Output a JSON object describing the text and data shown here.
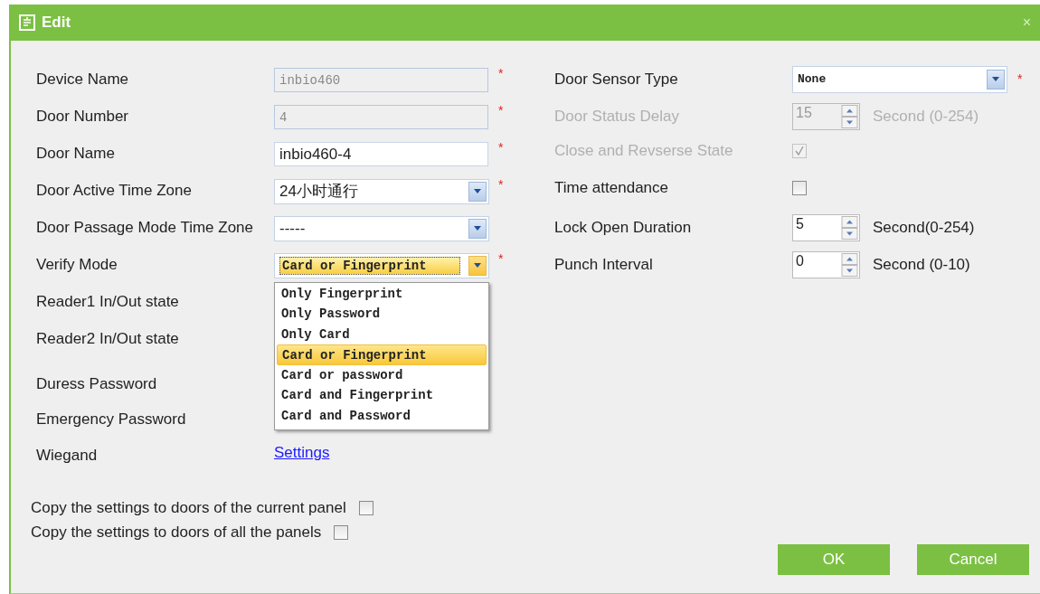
{
  "window": {
    "title": "Edit",
    "close": "×"
  },
  "left_fields": [
    {
      "label": "Device Name",
      "kind": "text",
      "value": "inbio460",
      "disabled": true,
      "mark": "*"
    },
    {
      "label": "Door Number",
      "kind": "text",
      "value": "4",
      "disabled": true,
      "mark": "*"
    },
    {
      "label": "Door Name",
      "kind": "text",
      "value": "inbio460-4",
      "disabled": false,
      "mark": "*"
    },
    {
      "label": "Door Active Time Zone",
      "kind": "select",
      "value": "24小时通行",
      "mark": "*"
    },
    {
      "label": "Door Passage Mode Time Zone",
      "kind": "select",
      "value": "-----"
    },
    {
      "label": "Verify Mode",
      "kind": "dropdown",
      "value": "Card or Fingerprint",
      "mark": "*",
      "expanded": true,
      "options": [
        {
          "label": "Only Fingerprint",
          "selected": false
        },
        {
          "label": "Only Password",
          "selected": false
        },
        {
          "label": "Only Card",
          "selected": false
        },
        {
          "label": "Card or Fingerprint",
          "selected": true
        },
        {
          "label": "Card or password",
          "selected": false
        },
        {
          "label": "Card and Fingerprint",
          "selected": false
        },
        {
          "label": "Card and Password",
          "selected": false
        }
      ]
    },
    {
      "label": "Reader1 In/Out state",
      "kind": "label"
    },
    {
      "label": "Reader2 In/Out state",
      "kind": "label"
    },
    {
      "label": "Duress Password",
      "kind": "label"
    },
    {
      "label": "Emergency Password",
      "kind": "label"
    },
    {
      "label": "Wiegand",
      "kind": "link",
      "value": "Settings"
    }
  ],
  "right_fields": [
    {
      "label": "Door Sensor Type",
      "kind": "select",
      "value": "None",
      "mark": "*"
    },
    {
      "label": "Door Status Delay",
      "kind": "spinner",
      "value": "15",
      "unit": "Second (0-254)",
      "disabled": true
    },
    {
      "label": "Close and Revserse State",
      "kind": "checkbox",
      "checked": true,
      "disabled": true
    },
    {
      "label": "Time attendance",
      "kind": "checkbox",
      "checked": false,
      "disabled": false
    },
    {
      "label": "Lock Open Duration",
      "kind": "spinner",
      "value": "5",
      "unit": "Second(0-254)",
      "disabled": false
    },
    {
      "label": "Punch Interval",
      "kind": "spinner",
      "value": "0",
      "unit": "Second (0-10)",
      "disabled": false
    }
  ],
  "copy_options": [
    {
      "label": "Copy the settings to doors of the current panel",
      "checked": false
    },
    {
      "label": "Copy the settings to doors of all the panels",
      "checked": false
    }
  ],
  "buttons": [
    "OK",
    "Cancel"
  ]
}
